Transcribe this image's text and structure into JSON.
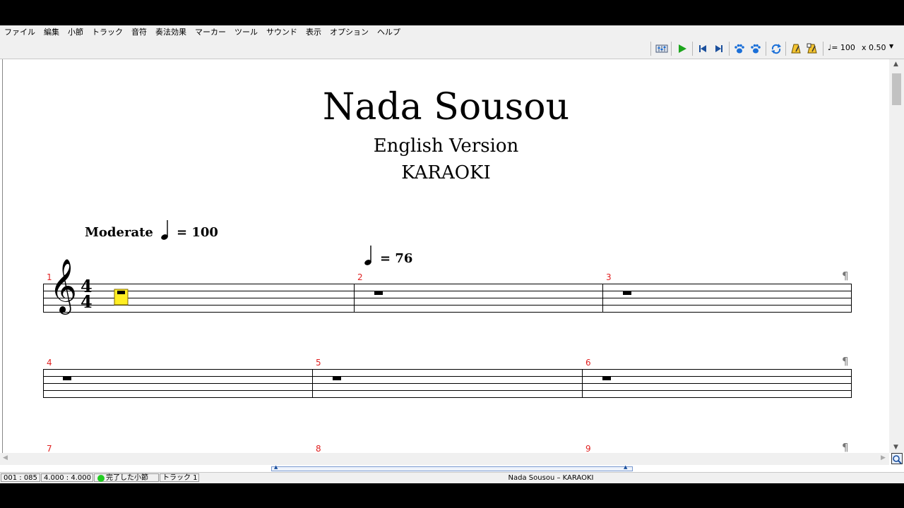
{
  "menu": [
    "ファイル",
    "編集",
    "小節",
    "トラック",
    "音符",
    "奏法効果",
    "マーカー",
    "ツール",
    "サウンド",
    "表示",
    "オプション",
    "ヘルプ"
  ],
  "toolbar": {
    "tempo": "♩= 100",
    "speed": "x 0.50",
    "icons": [
      "mixer-icon",
      "play-icon",
      "skip-start-icon",
      "skip-end-icon",
      "paw-icon",
      "paw-icon",
      "loop-icon",
      "metronome-icon",
      "metronome-count-icon",
      "speed-dropdown-icon"
    ]
  },
  "score": {
    "title": "Nada Sousou",
    "subtitle": "English Version",
    "subtitle2": "KARAOKI",
    "tempo_marking": "Moderate",
    "tempo_main": "= 100",
    "tempo_change": "= 76",
    "time_signature_top": "4",
    "time_signature_bottom": "4",
    "measures": [
      "1",
      "2",
      "3",
      "4",
      "5",
      "6",
      "7",
      "8",
      "9"
    ],
    "line_end_mark": "¶"
  },
  "status": {
    "position": "001 : 085",
    "time": "4.000 : 4.000",
    "completed": "完了した小節",
    "track": "トラック 1",
    "center": "Nada Sousou – KARAOKI"
  },
  "colors": {
    "measure_number": "#e02020",
    "cursor": "#ffee22",
    "completed_indicator": "#22cc22",
    "toolbar_icon_blue": "#1a6fd8",
    "play_green": "#1ca51c"
  }
}
